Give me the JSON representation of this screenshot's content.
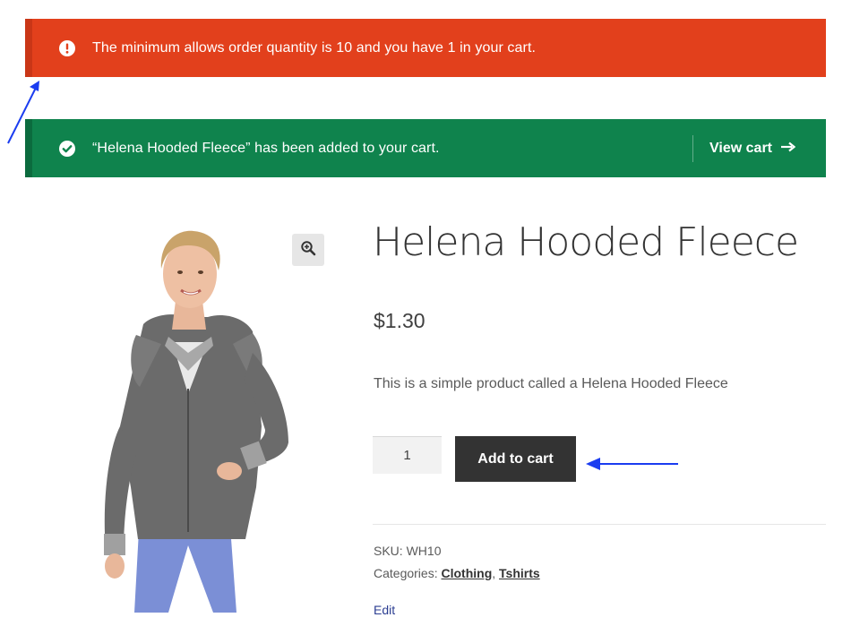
{
  "notices": {
    "error": {
      "text": "The minimum allows order quantity is 10 and you have 1 in your cart.",
      "color": "#e2401c",
      "icon": "exclamation-circle-icon"
    },
    "success": {
      "text": "“Helena Hooded Fleece” has been added to your cart.",
      "color": "#0f834d",
      "icon": "check-circle-icon",
      "view_cart_label": "View cart",
      "view_cart_icon": "arrow-right-icon"
    }
  },
  "product": {
    "title": "Helena Hooded Fleece",
    "price": "$1.30",
    "description": "This is a simple product called a Helena Hooded Fleece",
    "image_icon": "zoom-in-icon",
    "quantity": "1",
    "add_to_cart_label": "Add to cart",
    "sku_label": "SKU:",
    "sku": "WH10",
    "categories_label": "Categories:",
    "categories": [
      "Clothing",
      "Tshirts"
    ],
    "edit_label": "Edit"
  },
  "annotations": {
    "arrow_color": "#1a3cf0"
  }
}
